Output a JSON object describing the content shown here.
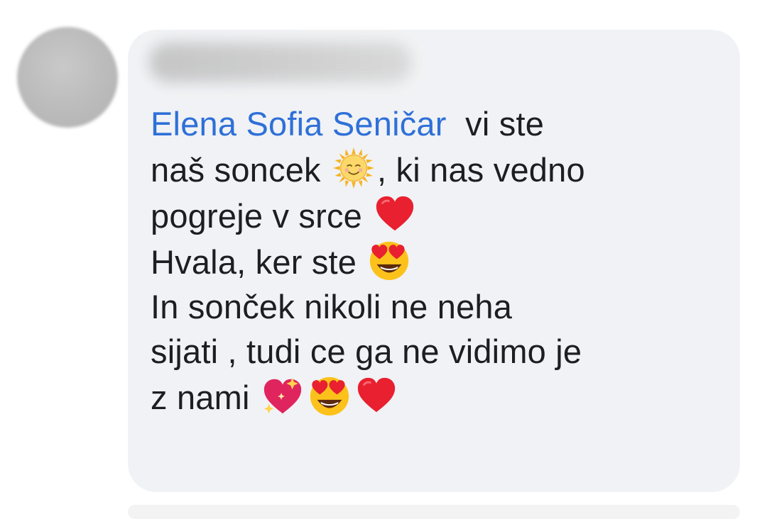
{
  "comment": {
    "author_name": "████████",
    "mention": "Elena Sofia Seničar",
    "lines": [
      {
        "after_mention": "  vi ste"
      },
      {
        "before_emoji": "naš soncek ",
        "emoji": "sun-with-face-emoji",
        "after_emoji": ", ki nas vedno"
      },
      {
        "before_emoji": "pogreje v srce ",
        "emoji": "red-heart-emoji"
      },
      {
        "before_emoji": "Hvala, ker ste ",
        "emoji": "heart-eyes-emoji"
      },
      {
        "text": "In sonček nikoli ne neha"
      },
      {
        "text": "sijati , tudi ce ga ne vidimo je"
      },
      {
        "before_emoji": "z nami ",
        "emojis": [
          "sparkling-heart-emoji",
          "heart-eyes-emoji",
          "red-heart-emoji"
        ]
      }
    ]
  },
  "colors": {
    "mention": "#2f70d8",
    "text": "#1c1e21",
    "bubble": "#f0f2f5"
  }
}
